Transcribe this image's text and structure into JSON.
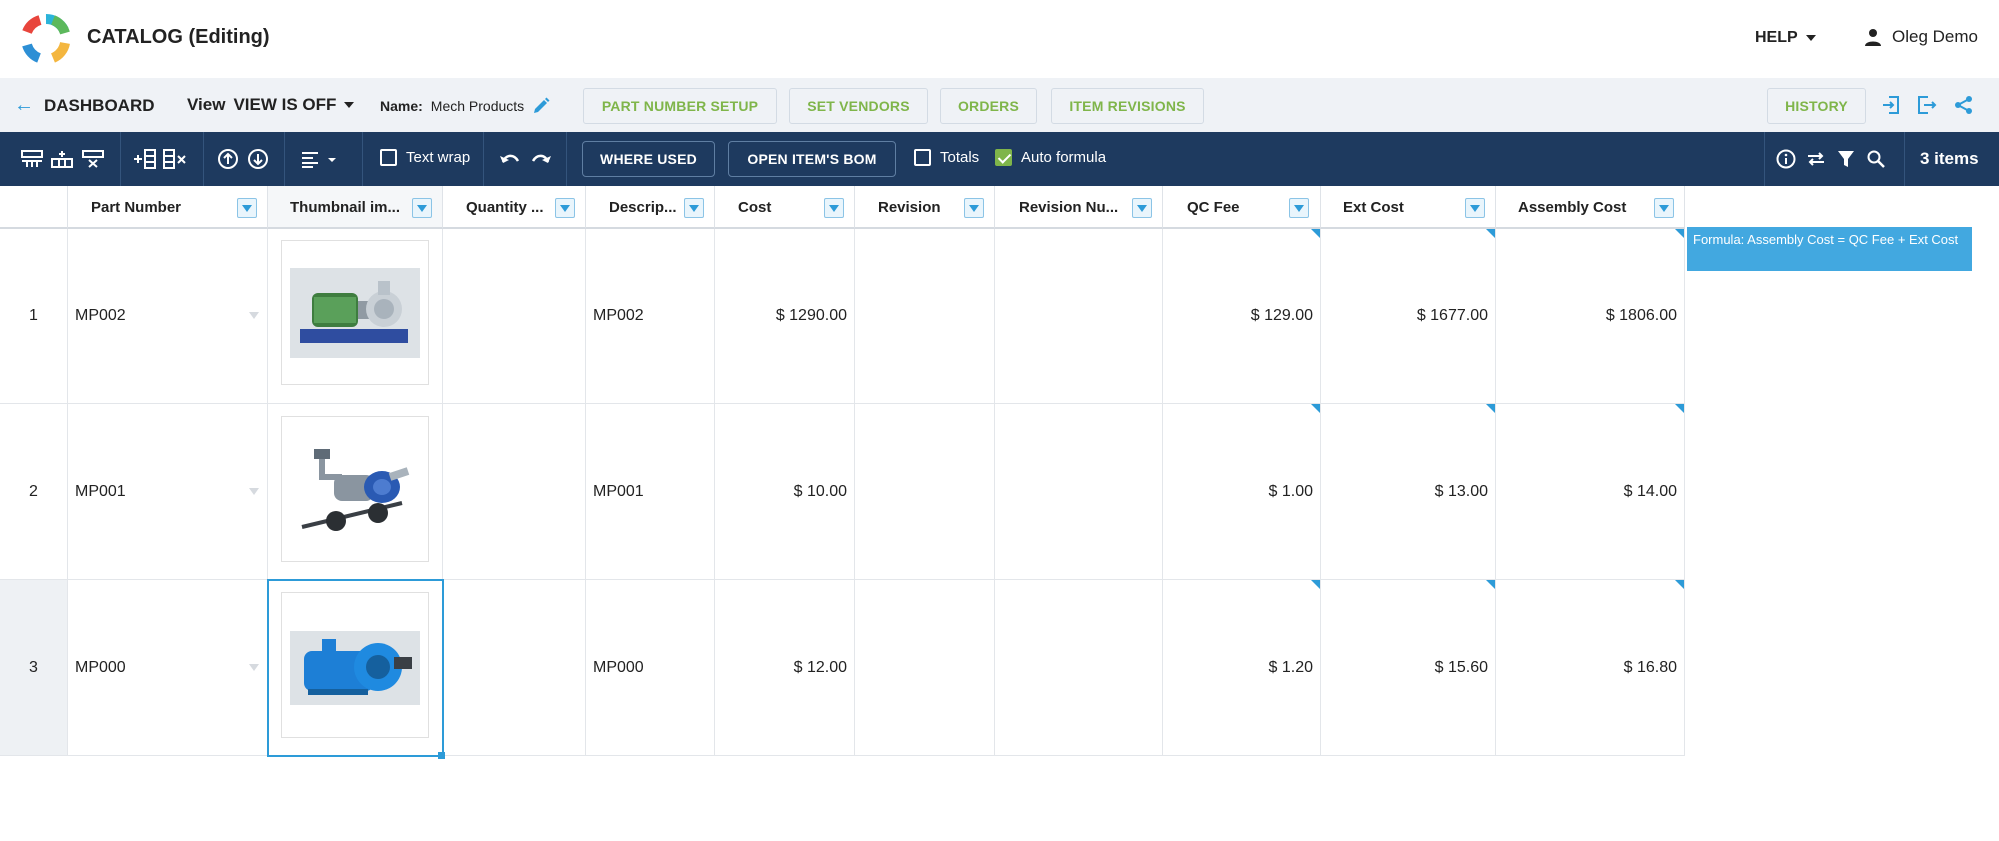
{
  "header": {
    "app_title": "CATALOG (Editing)",
    "help_label": "HELP",
    "user_name": "Oleg Demo"
  },
  "subbar": {
    "back_label": "DASHBOARD",
    "view_prefix": "View",
    "view_value": "VIEW IS OFF",
    "name_label": "Name:",
    "name_value": "Mech Products",
    "buttons": [
      "PART NUMBER SETUP",
      "SET VENDORS",
      "ORDERS",
      "ITEM REVISIONS"
    ],
    "history_label": "HISTORY"
  },
  "toolbar": {
    "text_wrap_label": "Text wrap",
    "where_used_label": "WHERE USED",
    "open_bom_label": "OPEN ITEM'S BOM",
    "totals_label": "Totals",
    "auto_formula_label": "Auto formula",
    "items_count": "3 items"
  },
  "grid": {
    "columns": [
      "Part Number",
      "Thumbnail im...",
      "Quantity ...",
      "Descrip...",
      "Cost",
      "Revision",
      "Revision Nu...",
      "QC Fee",
      "Ext Cost",
      "Assembly Cost"
    ],
    "rows": [
      {
        "row_num": "1",
        "part_number": "MP002",
        "quantity": "",
        "description": "MP002",
        "cost": "$ 1290.00",
        "revision": "",
        "revision_num": "",
        "qc_fee": "$ 129.00",
        "ext_cost": "$ 1677.00",
        "assembly_cost": "$ 1806.00"
      },
      {
        "row_num": "2",
        "part_number": "MP001",
        "quantity": "",
        "description": "MP001",
        "cost": "$ 10.00",
        "revision": "",
        "revision_num": "",
        "qc_fee": "$ 1.00",
        "ext_cost": "$ 13.00",
        "assembly_cost": "$ 14.00"
      },
      {
        "row_num": "3",
        "part_number": "MP000",
        "quantity": "",
        "description": "MP000",
        "cost": "$ 12.00",
        "revision": "",
        "revision_num": "",
        "qc_fee": "$ 1.20",
        "ext_cost": "$ 15.60",
        "assembly_cost": "$ 16.80"
      }
    ]
  },
  "tooltip": {
    "text": "Formula: Assembly Cost = QC Fee + Ext Cost"
  },
  "colors": {
    "toolbar_bg": "#1e3a5f",
    "accent_blue": "#2d9bd8",
    "accent_green": "#7fb54a"
  }
}
